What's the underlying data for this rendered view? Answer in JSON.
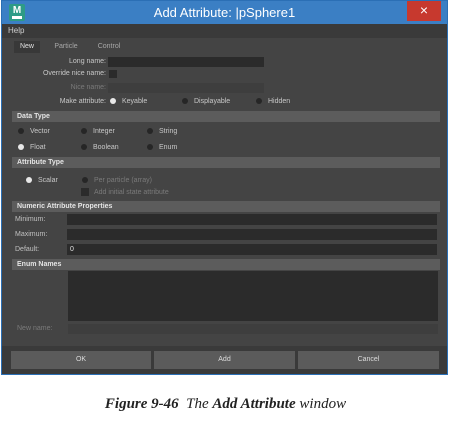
{
  "window": {
    "title": "Add Attribute: |pSphere1",
    "app_icon_letter": "M",
    "close_symbol": "×",
    "menu": [
      "Help"
    ]
  },
  "tabs": [
    "New",
    "Particle",
    "Control"
  ],
  "active_tab": "New",
  "form": {
    "long_name_label": "Long name:",
    "long_name_value": "",
    "override_nice_name_label": "Override nice name:",
    "nice_name_label": "Nice name:",
    "make_attribute_label": "Make attribute:",
    "make_attribute_options": [
      "Keyable",
      "Displayable",
      "Hidden"
    ],
    "make_attribute_selected": "Keyable"
  },
  "data_type": {
    "header": "Data Type",
    "options": [
      "Vector",
      "Integer",
      "String",
      "Float",
      "Boolean",
      "Enum"
    ],
    "selected": "Float"
  },
  "attribute_type": {
    "header": "Attribute Type",
    "scalar_label": "Scalar",
    "per_particle_label": "Per particle (array)",
    "add_initial_state_label": "Add initial state attribute",
    "selected": "Scalar"
  },
  "numeric": {
    "header": "Numeric Attribute Properties",
    "minimum_label": "Minimum:",
    "maximum_label": "Maximum:",
    "default_label": "Default:",
    "default_value": "0"
  },
  "enum": {
    "header": "Enum Names",
    "new_name_label": "New name:"
  },
  "buttons": {
    "ok": "OK",
    "add": "Add",
    "cancel": "Cancel"
  },
  "caption": {
    "figure": "Figure 9-46",
    "text_before": "The",
    "text_bold": "Add Attribute",
    "text_after": "window"
  },
  "colors": {
    "titlebar": "#3b7fc4",
    "close": "#c7392e",
    "panel": "#444444",
    "section": "#5c5c5c"
  }
}
